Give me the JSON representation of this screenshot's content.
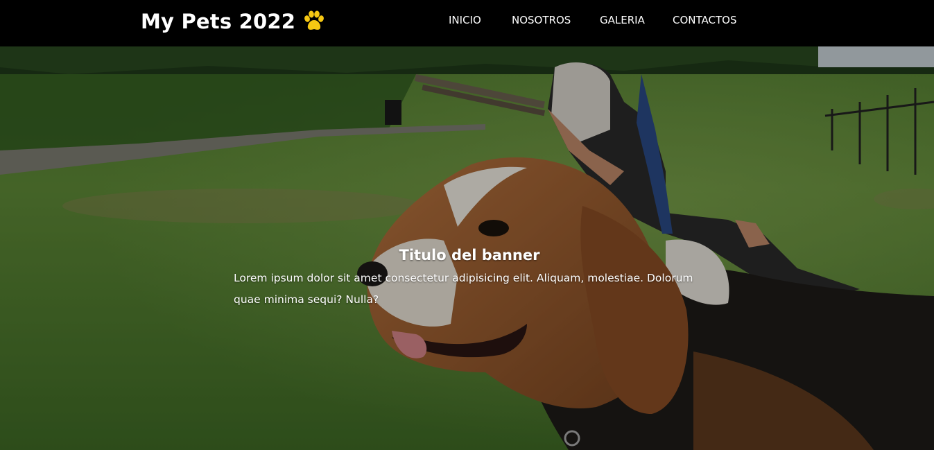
{
  "navbar": {
    "brand": "My Pets 2022",
    "brand_icon": "paw-icon",
    "brand_icon_color": "#f6c813",
    "items": [
      {
        "label": "INICIO"
      },
      {
        "label": "NOSOTROS"
      },
      {
        "label": "GALERIA"
      },
      {
        "label": "CONTACTOS"
      }
    ]
  },
  "hero": {
    "title": "Titulo del banner",
    "text": "Lorem ipsum dolor sit amet consectetur adipisicing elit. Aliquam, molestiae. Dolorum quae minima sequi? Nulla?"
  }
}
